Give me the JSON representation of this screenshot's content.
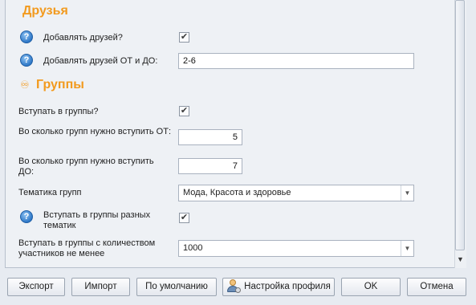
{
  "sections": {
    "friends": {
      "title": "Друзья",
      "add_friends_label": "Добавлять друзей?",
      "add_friends_checked": true,
      "friends_range_label": "Добавлять друзей ОТ и ДО:",
      "friends_range_value": "2-6"
    },
    "groups": {
      "title": "Группы",
      "join_groups_label": "Вступать в группы?",
      "join_groups_checked": true,
      "from_label": "Во сколько групп нужно вступить ОТ:",
      "from_value": "5",
      "to_label": "Во сколько групп нужно вступить ДО:",
      "to_value": "7",
      "topic_label": "Тематика групп",
      "topic_value": "Мода, Красота и здоровье",
      "diff_topics_label": "Вступать в группы разных тематик",
      "diff_topics_checked": true,
      "min_members_label": "Вступать в группы с количеством участников не менее",
      "min_members_value": "1000"
    }
  },
  "buttons": {
    "export": "Экспорт",
    "import": "Импорт",
    "default": "По умолчанию",
    "profile_settings": "Настройка профиля",
    "ok": "OK",
    "cancel": "Отмена"
  },
  "icons": {
    "help": "question-icon",
    "group": "group-icon",
    "user": "user-settings-icon"
  },
  "colors": {
    "section_title": "#f29a1e",
    "help_icon": "#2f78c7"
  }
}
